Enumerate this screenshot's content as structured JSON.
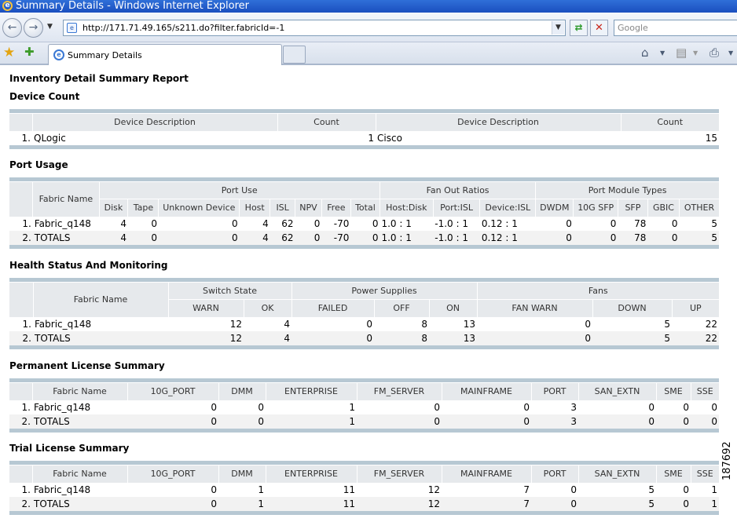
{
  "window": {
    "title": "Summary Details - Windows Internet Explorer"
  },
  "address": {
    "url": "http://171.71.49.165/s211.do?filter.fabricId=-1"
  },
  "search": {
    "placeholder": "Google"
  },
  "tab": {
    "label": "Summary Details"
  },
  "report": {
    "title": "Inventory Detail Summary Report",
    "device_count": {
      "title": "Device Count",
      "headers": [
        "Device Description",
        "Count",
        "Device Description",
        "Count"
      ],
      "rows": [
        {
          "idx": "1.",
          "desc1": "QLogic",
          "count1": "1",
          "desc2": "Cisco",
          "count2": "15"
        }
      ]
    },
    "port_usage": {
      "title": "Port Usage",
      "group_headers": [
        "Fabric Name",
        "Port Use",
        "Fan Out Ratios",
        "Port Module Types"
      ],
      "headers": [
        "Disk",
        "Tape",
        "Unknown Device",
        "Host",
        "ISL",
        "NPV",
        "Free",
        "Total",
        "Host:Disk",
        "Port:ISL",
        "Device:ISL",
        "DWDM",
        "10G SFP",
        "SFP",
        "GBIC",
        "OTHER"
      ],
      "rows": [
        {
          "idx": "1.",
          "name": "Fabric_q148",
          "cells": [
            "4",
            "0",
            "0",
            "4",
            "62",
            "0",
            "-70",
            "0",
            "1.0 : 1",
            "-1.0 : 1",
            "0.12 : 1",
            "0",
            "0",
            "78",
            "0",
            "5"
          ]
        },
        {
          "idx": "2.",
          "name": "TOTALS",
          "cells": [
            "4",
            "0",
            "0",
            "4",
            "62",
            "0",
            "-70",
            "0",
            "1.0 : 1",
            "-1.0 : 1",
            "0.12 : 1",
            "0",
            "0",
            "78",
            "0",
            "5"
          ]
        }
      ]
    },
    "health": {
      "title": "Health Status And Monitoring",
      "group_headers": [
        "Fabric Name",
        "Switch State",
        "Power Supplies",
        "Fans"
      ],
      "headers": [
        "WARN",
        "OK",
        "FAILED",
        "OFF",
        "ON",
        "FAN WARN",
        "DOWN",
        "UP"
      ],
      "rows": [
        {
          "idx": "1.",
          "name": "Fabric_q148",
          "cells": [
            "12",
            "4",
            "0",
            "8",
            "13",
            "0",
            "5",
            "22"
          ]
        },
        {
          "idx": "2.",
          "name": "TOTALS",
          "cells": [
            "12",
            "4",
            "0",
            "8",
            "13",
            "0",
            "5",
            "22"
          ]
        }
      ]
    },
    "permanent_license": {
      "title": "Permanent License Summary",
      "headers": [
        "Fabric Name",
        "10G_PORT",
        "DMM",
        "ENTERPRISE",
        "FM_SERVER",
        "MAINFRAME",
        "PORT",
        "SAN_EXTN",
        "SME",
        "SSE"
      ],
      "rows": [
        {
          "idx": "1.",
          "name": "Fabric_q148",
          "cells": [
            "0",
            "0",
            "1",
            "0",
            "0",
            "3",
            "0",
            "0",
            "0"
          ]
        },
        {
          "idx": "2.",
          "name": "TOTALS",
          "cells": [
            "0",
            "0",
            "1",
            "0",
            "0",
            "3",
            "0",
            "0",
            "0"
          ]
        }
      ]
    },
    "trial_license": {
      "title": "Trial License Summary",
      "headers": [
        "Fabric Name",
        "10G_PORT",
        "DMM",
        "ENTERPRISE",
        "FM_SERVER",
        "MAINFRAME",
        "PORT",
        "SAN_EXTN",
        "SME",
        "SSE"
      ],
      "rows": [
        {
          "idx": "1.",
          "name": "Fabric_q148",
          "cells": [
            "0",
            "1",
            "11",
            "12",
            "7",
            "0",
            "5",
            "0",
            "1"
          ]
        },
        {
          "idx": "2.",
          "name": "TOTALS",
          "cells": [
            "0",
            "1",
            "11",
            "12",
            "7",
            "0",
            "5",
            "0",
            "1"
          ]
        }
      ]
    }
  },
  "figure_id": "187692"
}
